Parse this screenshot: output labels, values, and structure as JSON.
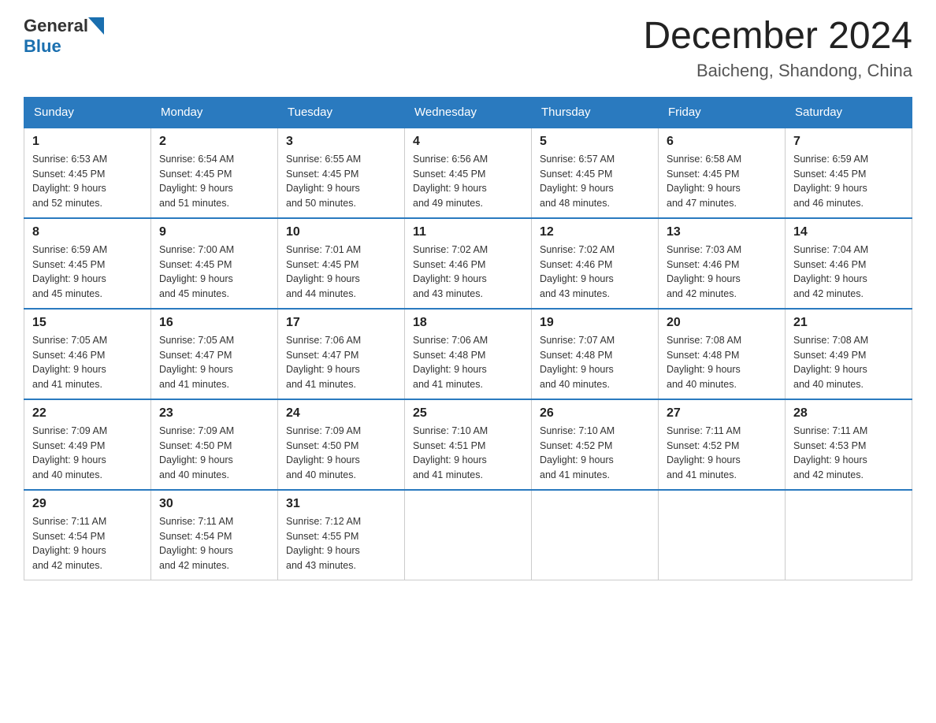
{
  "header": {
    "logo_general": "General",
    "logo_blue": "Blue",
    "month_title": "December 2024",
    "location": "Baicheng, Shandong, China"
  },
  "days_of_week": [
    "Sunday",
    "Monday",
    "Tuesday",
    "Wednesday",
    "Thursday",
    "Friday",
    "Saturday"
  ],
  "weeks": [
    [
      {
        "day": "1",
        "info": "Sunrise: 6:53 AM\nSunset: 4:45 PM\nDaylight: 9 hours\nand 52 minutes."
      },
      {
        "day": "2",
        "info": "Sunrise: 6:54 AM\nSunset: 4:45 PM\nDaylight: 9 hours\nand 51 minutes."
      },
      {
        "day": "3",
        "info": "Sunrise: 6:55 AM\nSunset: 4:45 PM\nDaylight: 9 hours\nand 50 minutes."
      },
      {
        "day": "4",
        "info": "Sunrise: 6:56 AM\nSunset: 4:45 PM\nDaylight: 9 hours\nand 49 minutes."
      },
      {
        "day": "5",
        "info": "Sunrise: 6:57 AM\nSunset: 4:45 PM\nDaylight: 9 hours\nand 48 minutes."
      },
      {
        "day": "6",
        "info": "Sunrise: 6:58 AM\nSunset: 4:45 PM\nDaylight: 9 hours\nand 47 minutes."
      },
      {
        "day": "7",
        "info": "Sunrise: 6:59 AM\nSunset: 4:45 PM\nDaylight: 9 hours\nand 46 minutes."
      }
    ],
    [
      {
        "day": "8",
        "info": "Sunrise: 6:59 AM\nSunset: 4:45 PM\nDaylight: 9 hours\nand 45 minutes."
      },
      {
        "day": "9",
        "info": "Sunrise: 7:00 AM\nSunset: 4:45 PM\nDaylight: 9 hours\nand 45 minutes."
      },
      {
        "day": "10",
        "info": "Sunrise: 7:01 AM\nSunset: 4:45 PM\nDaylight: 9 hours\nand 44 minutes."
      },
      {
        "day": "11",
        "info": "Sunrise: 7:02 AM\nSunset: 4:46 PM\nDaylight: 9 hours\nand 43 minutes."
      },
      {
        "day": "12",
        "info": "Sunrise: 7:02 AM\nSunset: 4:46 PM\nDaylight: 9 hours\nand 43 minutes."
      },
      {
        "day": "13",
        "info": "Sunrise: 7:03 AM\nSunset: 4:46 PM\nDaylight: 9 hours\nand 42 minutes."
      },
      {
        "day": "14",
        "info": "Sunrise: 7:04 AM\nSunset: 4:46 PM\nDaylight: 9 hours\nand 42 minutes."
      }
    ],
    [
      {
        "day": "15",
        "info": "Sunrise: 7:05 AM\nSunset: 4:46 PM\nDaylight: 9 hours\nand 41 minutes."
      },
      {
        "day": "16",
        "info": "Sunrise: 7:05 AM\nSunset: 4:47 PM\nDaylight: 9 hours\nand 41 minutes."
      },
      {
        "day": "17",
        "info": "Sunrise: 7:06 AM\nSunset: 4:47 PM\nDaylight: 9 hours\nand 41 minutes."
      },
      {
        "day": "18",
        "info": "Sunrise: 7:06 AM\nSunset: 4:48 PM\nDaylight: 9 hours\nand 41 minutes."
      },
      {
        "day": "19",
        "info": "Sunrise: 7:07 AM\nSunset: 4:48 PM\nDaylight: 9 hours\nand 40 minutes."
      },
      {
        "day": "20",
        "info": "Sunrise: 7:08 AM\nSunset: 4:48 PM\nDaylight: 9 hours\nand 40 minutes."
      },
      {
        "day": "21",
        "info": "Sunrise: 7:08 AM\nSunset: 4:49 PM\nDaylight: 9 hours\nand 40 minutes."
      }
    ],
    [
      {
        "day": "22",
        "info": "Sunrise: 7:09 AM\nSunset: 4:49 PM\nDaylight: 9 hours\nand 40 minutes."
      },
      {
        "day": "23",
        "info": "Sunrise: 7:09 AM\nSunset: 4:50 PM\nDaylight: 9 hours\nand 40 minutes."
      },
      {
        "day": "24",
        "info": "Sunrise: 7:09 AM\nSunset: 4:50 PM\nDaylight: 9 hours\nand 40 minutes."
      },
      {
        "day": "25",
        "info": "Sunrise: 7:10 AM\nSunset: 4:51 PM\nDaylight: 9 hours\nand 41 minutes."
      },
      {
        "day": "26",
        "info": "Sunrise: 7:10 AM\nSunset: 4:52 PM\nDaylight: 9 hours\nand 41 minutes."
      },
      {
        "day": "27",
        "info": "Sunrise: 7:11 AM\nSunset: 4:52 PM\nDaylight: 9 hours\nand 41 minutes."
      },
      {
        "day": "28",
        "info": "Sunrise: 7:11 AM\nSunset: 4:53 PM\nDaylight: 9 hours\nand 42 minutes."
      }
    ],
    [
      {
        "day": "29",
        "info": "Sunrise: 7:11 AM\nSunset: 4:54 PM\nDaylight: 9 hours\nand 42 minutes."
      },
      {
        "day": "30",
        "info": "Sunrise: 7:11 AM\nSunset: 4:54 PM\nDaylight: 9 hours\nand 42 minutes."
      },
      {
        "day": "31",
        "info": "Sunrise: 7:12 AM\nSunset: 4:55 PM\nDaylight: 9 hours\nand 43 minutes."
      },
      {
        "day": "",
        "info": ""
      },
      {
        "day": "",
        "info": ""
      },
      {
        "day": "",
        "info": ""
      },
      {
        "day": "",
        "info": ""
      }
    ]
  ]
}
